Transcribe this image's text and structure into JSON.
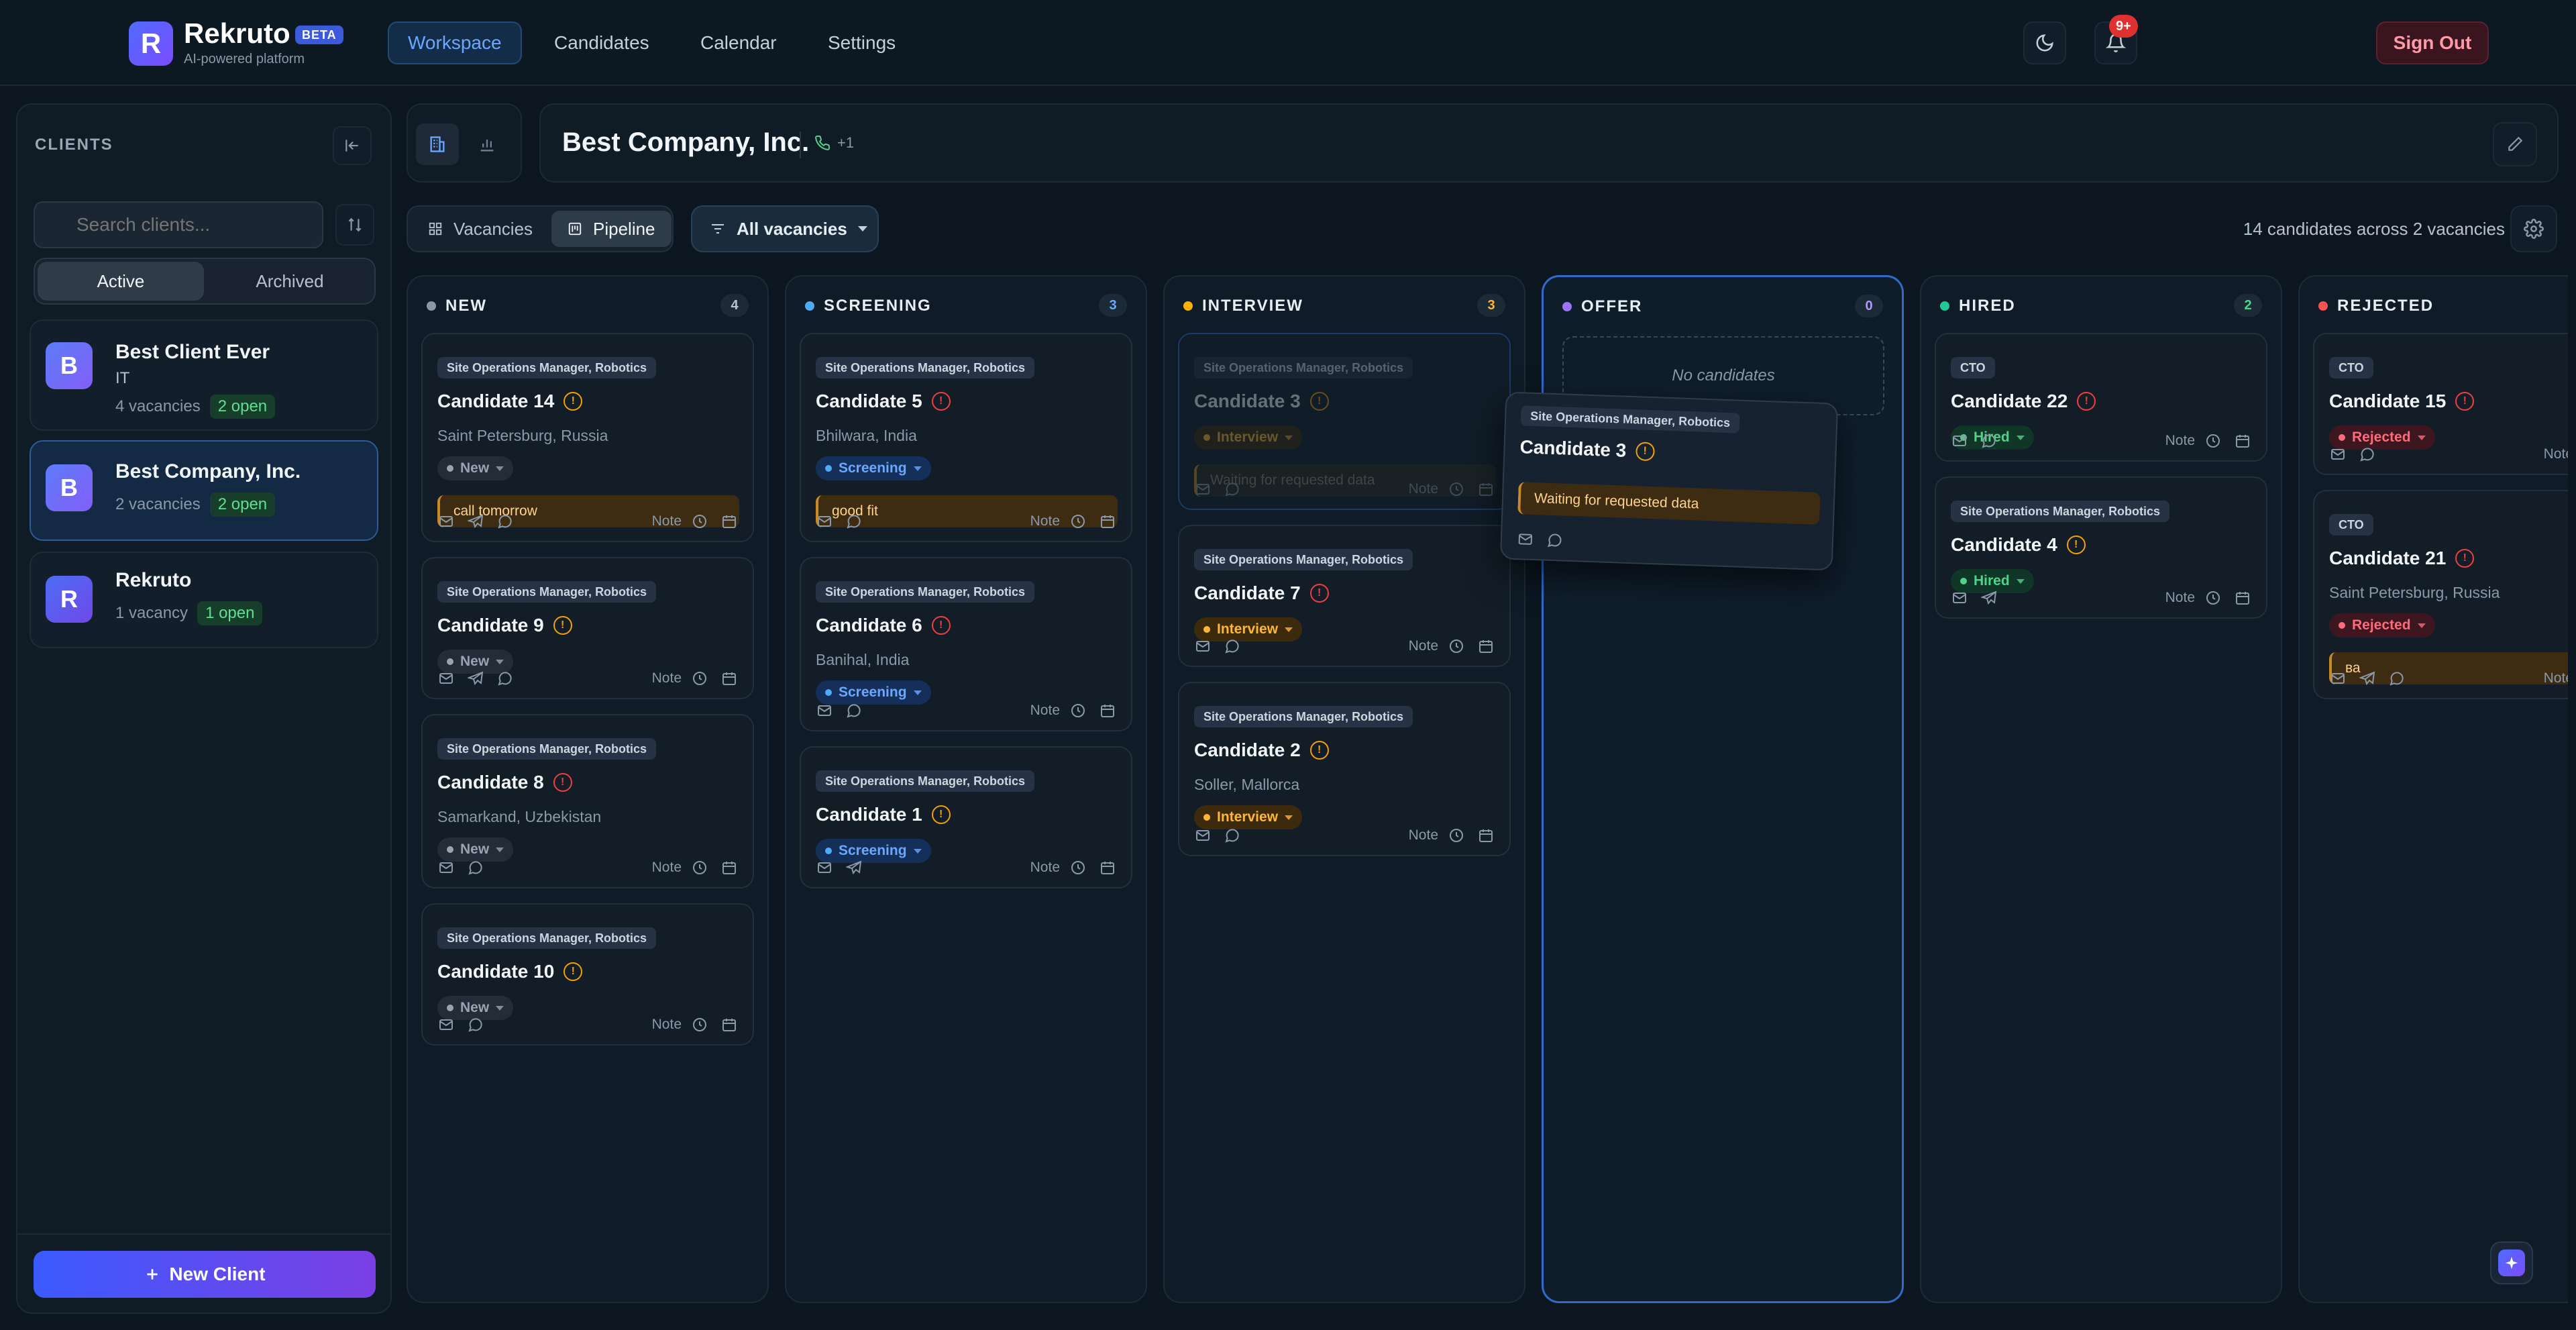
{
  "brand": {
    "initial": "R",
    "name": "Rekruto",
    "badge": "BETA",
    "tagline": "AI-powered platform"
  },
  "nav": [
    {
      "label": "Workspace"
    },
    {
      "label": "Candidates"
    },
    {
      "label": "Calendar"
    },
    {
      "label": "Settings"
    }
  ],
  "header": {
    "notif_badge": "9+",
    "sign_out": "Sign Out"
  },
  "sidebar": {
    "title": "CLIENTS",
    "search_placeholder": "Search clients...",
    "filters": [
      "Active",
      "Archived"
    ],
    "new_client": "New Client",
    "clients": [
      {
        "initial": "B",
        "name": "Best Client Ever",
        "industry": "IT",
        "vacancies": "4 vacancies",
        "open": "2 open"
      },
      {
        "initial": "B",
        "name": "Best Company, Inc.",
        "vacancies": "2 vacancies",
        "open": "2 open"
      },
      {
        "initial": "R",
        "name": "Rekruto",
        "vacancies": "1 vacancy",
        "open": "1 open"
      }
    ]
  },
  "company": {
    "name": "Best Company, Inc.",
    "phone_extra": "+1"
  },
  "toolbar": {
    "views": [
      "Vacancies",
      "Pipeline"
    ],
    "filter": "All vacancies",
    "summary": "14 candidates across 2 vacancies"
  },
  "board": {
    "note_label": "Note",
    "columns": [
      {
        "title": "NEW",
        "count": "4",
        "cards": [
          {
            "tag": "Site Operations Manager, Robotics",
            "name": "Candidate 14",
            "location": "Saint Petersburg, Russia",
            "status": "New",
            "note": "call tomorrow"
          },
          {
            "tag": "Site Operations Manager, Robotics",
            "name": "Candidate 9",
            "status": "New"
          },
          {
            "tag": "Site Operations Manager, Robotics",
            "name": "Candidate 8",
            "location": "Samarkand, Uzbekistan",
            "status": "New"
          },
          {
            "tag": "Site Operations Manager, Robotics",
            "name": "Candidate 10",
            "status": "New"
          }
        ]
      },
      {
        "title": "SCREENING",
        "count": "3",
        "cards": [
          {
            "tag": "Site Operations Manager, Robotics",
            "name": "Candidate 5",
            "location": "Bhilwara, India",
            "status": "Screening",
            "note": "good fit"
          },
          {
            "tag": "Site Operations Manager, Robotics",
            "name": "Candidate 6",
            "location": "Banihal, India",
            "status": "Screening"
          },
          {
            "tag": "Site Operations Manager, Robotics",
            "name": "Candidate 1",
            "status": "Screening"
          }
        ]
      },
      {
        "title": "INTERVIEW",
        "count": "3",
        "cards": [
          {
            "tag": "Site Operations Manager, Robotics",
            "name": "Candidate 3",
            "status": "Interview",
            "note": "Waiting for requested data"
          },
          {
            "tag": "Site Operations Manager, Robotics",
            "name": "Candidate 7",
            "status": "Interview"
          },
          {
            "tag": "Site Operations Manager, Robotics",
            "name": "Candidate 2",
            "location": "Soller, Mallorca",
            "status": "Interview"
          }
        ]
      },
      {
        "title": "OFFER",
        "count": "0",
        "empty": "No candidates"
      },
      {
        "title": "HIRED",
        "count": "2",
        "cards": [
          {
            "tag": "CTO",
            "name": "Candidate 22",
            "status": "Hired"
          },
          {
            "tag": "Site Operations Manager, Robotics",
            "name": "Candidate 4",
            "status": "Hired"
          }
        ]
      },
      {
        "title": "REJECTED",
        "count": "",
        "cards": [
          {
            "tag": "CTO",
            "name": "Candidate 15",
            "status": "Rejected"
          },
          {
            "tag": "CTO",
            "name": "Candidate 21",
            "location": "Saint Petersburg, Russia",
            "status": "Rejected",
            "note": "ва"
          }
        ]
      }
    ],
    "dragging": {
      "tag": "Site Operations Manager, Robotics",
      "name": "Candidate 3",
      "note": "Waiting for requested data"
    }
  }
}
